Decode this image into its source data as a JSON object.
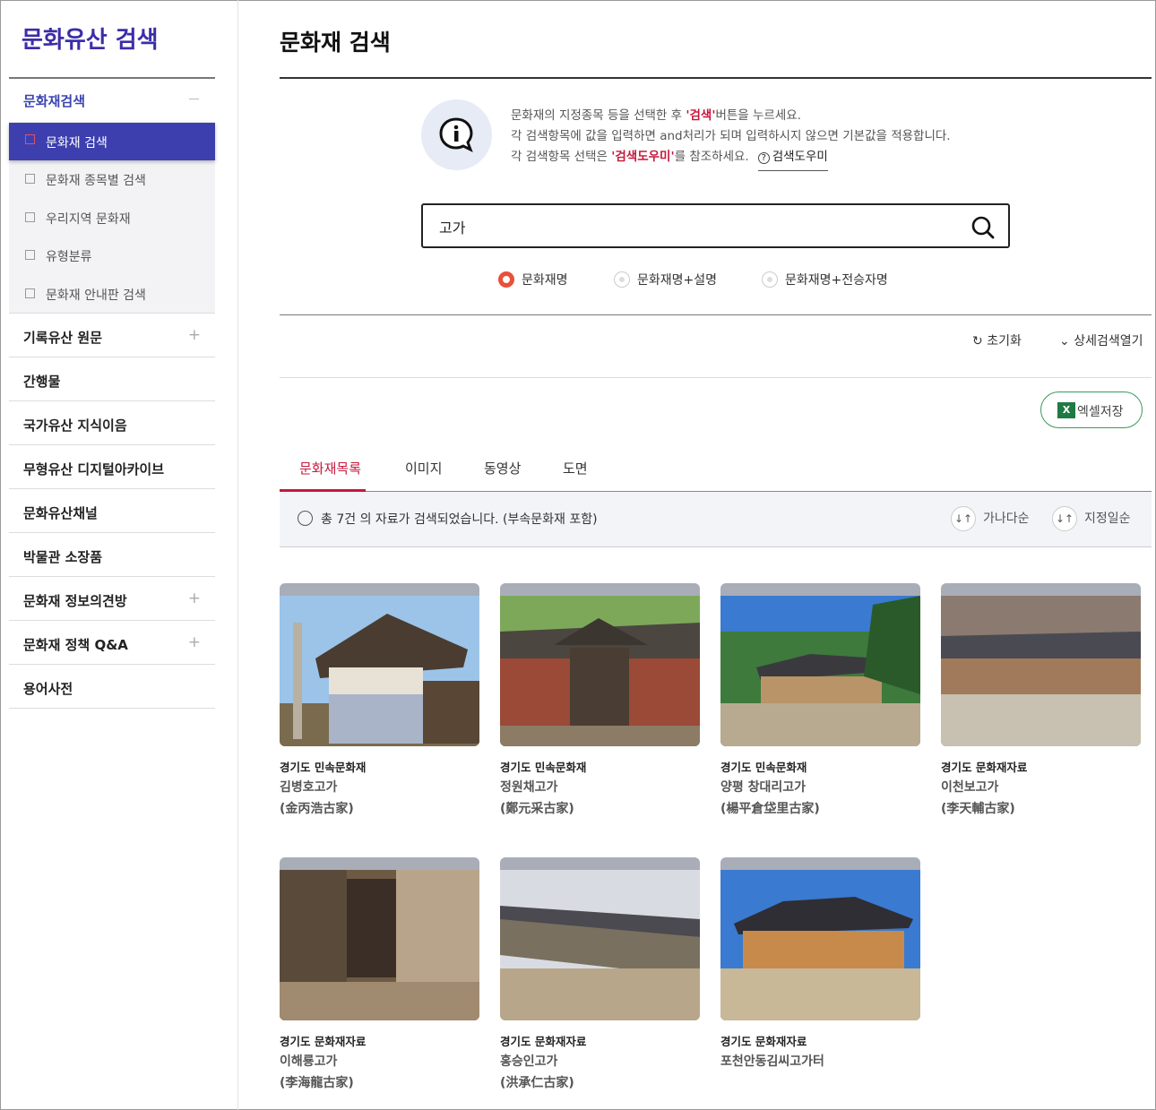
{
  "sidebar": {
    "title": "문화유산 검색",
    "group": {
      "label": "문화재검색"
    },
    "subitems": [
      {
        "label": "문화재 검색",
        "active": true
      },
      {
        "label": "문화재 종목별 검색"
      },
      {
        "label": "우리지역 문화재"
      },
      {
        "label": "유형분류"
      },
      {
        "label": "문화재 안내판 검색"
      }
    ],
    "items": [
      {
        "label": "기록유산 원문",
        "expandable": true
      },
      {
        "label": "간행물"
      },
      {
        "label": "국가유산 지식이음"
      },
      {
        "label": "무형유산 디지털아카이브"
      },
      {
        "label": "문화유산채널"
      },
      {
        "label": "박물관 소장품"
      },
      {
        "label": "문화재 정보의견방",
        "expandable": true
      },
      {
        "label": "문화재 정책 Q&A",
        "expandable": true
      },
      {
        "label": "용어사전"
      }
    ]
  },
  "main": {
    "title": "문화재 검색",
    "info": {
      "line1_pre": "문화재의 지정종목 등을 선택한 후 ",
      "line1_hl": "'검색'",
      "line1_post": "버튼을 누르세요.",
      "line2": "각 검색항목에 값을 입력하면 and처리가 되며 입력하시지 않으면 기본값을 적용합니다.",
      "line3_pre": "각 검색항목 선택은 ",
      "line3_hl": "'검색도우미'",
      "line3_post": "를 참조하세요.",
      "help_link": "검색도우미"
    },
    "search": {
      "value": "고가"
    },
    "radios": [
      {
        "label": "문화재명",
        "checked": true
      },
      {
        "label": "문화재명+설명",
        "checked": false
      },
      {
        "label": "문화재명+전승자명",
        "checked": false
      }
    ],
    "reset_label": "초기화",
    "detail_label": "상세검색열기",
    "excel_label": "엑셀저장",
    "tabs": [
      "문화재목록",
      "이미지",
      "동영상",
      "도면"
    ],
    "result_text": "총 7건 의 자료가 검색되었습니다. (부속문화재 포함)",
    "sort_options": [
      "가나다순",
      "지정일순"
    ],
    "cards": [
      {
        "category": "경기도 민속문화재",
        "name": "김병호고가",
        "hanja": "(金丙浩古家)"
      },
      {
        "category": "경기도 민속문화재",
        "name": "정원채고가",
        "hanja": "(鄭元采古家)"
      },
      {
        "category": "경기도 민속문화재",
        "name": "양평 창대리고가",
        "hanja": "(楊平倉垈里古家)"
      },
      {
        "category": "경기도 문화재자료",
        "name": "이천보고가",
        "hanja": "(李天輔古家)"
      },
      {
        "category": "경기도 문화재자료",
        "name": "이해룡고가",
        "hanja": "(李海龍古家)"
      },
      {
        "category": "경기도 문화재자료",
        "name": "홍승인고가",
        "hanja": "(洪承仁古家)"
      },
      {
        "category": "경기도 문화재자료",
        "name": "포천안동김씨고가터",
        "hanja": ""
      }
    ]
  },
  "colors": {
    "accent": "#3d3fae",
    "highlight": "#c8173c",
    "radio_on": "#e8503a",
    "excel": "#1f7a43"
  }
}
